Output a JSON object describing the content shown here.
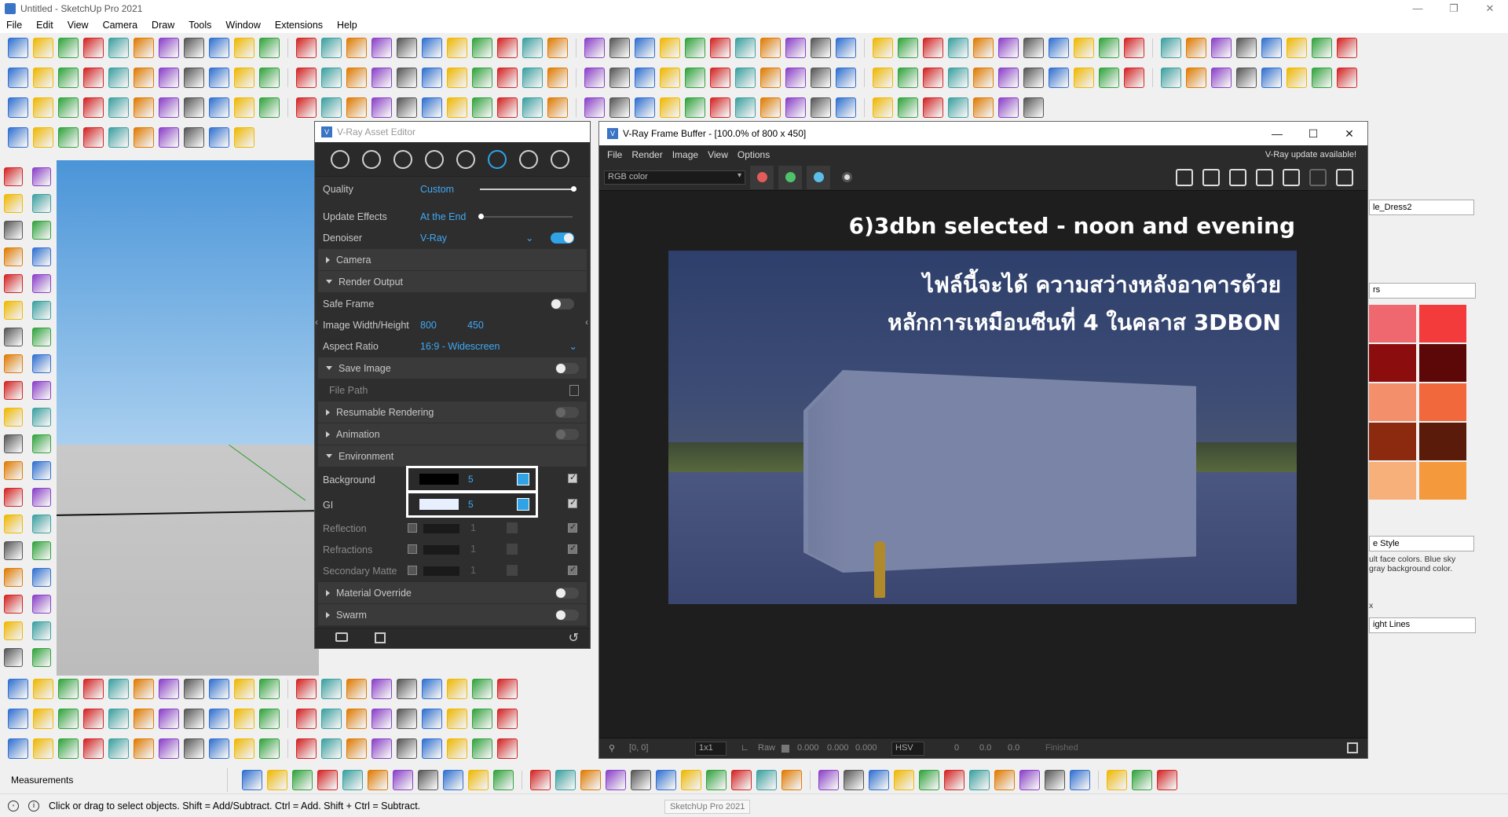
{
  "window": {
    "title": "Untitled - SketchUp Pro 2021"
  },
  "menu": [
    "File",
    "Edit",
    "View",
    "Camera",
    "Draw",
    "Tools",
    "Window",
    "Extensions",
    "Help"
  ],
  "measurements": {
    "label": "Measurements"
  },
  "status": {
    "hint": "Click or drag to select objects. Shift = Add/Subtract. Ctrl = Add. Shift + Ctrl = Subtract."
  },
  "tooltip": "SketchUp Pro 2021",
  "tray": {
    "material_name": "le_Dress2",
    "colors_select": "rs",
    "style_name": "e Style",
    "style_desc_1": "ult face colors. Blue sky",
    "style_desc_2": "gray background color.",
    "x_label": "x",
    "edge_select": "ight Lines",
    "swatches": [
      "#f0686f",
      "#f33b3b",
      "#8c0d0d",
      "#5c0808",
      "#f48f6c",
      "#f2683d",
      "#8c2a0f",
      "#5a1b0a",
      "#f7b07a",
      "#f59a3c"
    ]
  },
  "asset_editor": {
    "title": "V-Ray Asset Editor",
    "quality": {
      "label": "Quality",
      "value": "Custom"
    },
    "update_effects": {
      "label": "Update Effects",
      "value": "At the End"
    },
    "denoiser": {
      "label": "Denoiser",
      "value": "V-Ray"
    },
    "sections": {
      "camera": "Camera",
      "render_output": "Render Output",
      "save_image": "Save Image",
      "resumable": "Resumable Rendering",
      "animation": "Animation",
      "environment": "Environment",
      "material_override": "Material Override",
      "swarm": "Swarm"
    },
    "safe_frame": "Safe Frame",
    "image_size": {
      "label": "Image Width/Height",
      "width": "800",
      "height": "450"
    },
    "aspect_ratio": {
      "label": "Aspect Ratio",
      "value": "16:9 - Widescreen"
    },
    "file_path": "File Path",
    "environment": {
      "background": {
        "label": "Background",
        "value": "5"
      },
      "gi": {
        "label": "GI",
        "value": "5"
      },
      "reflection": {
        "label": "Reflection",
        "value": "1"
      },
      "refractions": {
        "label": "Refractions",
        "value": "1"
      },
      "secondary_matte": {
        "label": "Secondary Matte",
        "value": "1"
      }
    }
  },
  "frame_buffer": {
    "title": "V-Ray Frame Buffer - [100.0% of 800 x 450]",
    "menu": [
      "File",
      "Render",
      "Image",
      "View",
      "Options"
    ],
    "update_notice": "V-Ray update available!",
    "channel": "RGB color",
    "heading": "6)3dbn selected - noon and evening",
    "overlay_line1": "ไฟล์นี้จะได้ ความสว่างหลังอาคารด้วย",
    "overlay_line2": "หลักการเหมือนซีนที่ 4 ในคลาส 3DBON",
    "status": {
      "coords": "[0, 0]",
      "zoom": "1x1",
      "raw": "Raw",
      "r": "0.000",
      "g": "0.000",
      "b": "0.000",
      "color_mode": "HSV",
      "h": "0",
      "s": "0.0",
      "v": "0.0",
      "state": "Finished"
    }
  },
  "colors": {
    "accent": "#2fa3e6",
    "sky_top": "#4a95d8",
    "toolbar_red": "#d42222",
    "toolbar_green": "#2fa33b",
    "toolbar_yellow": "#f0b800"
  }
}
